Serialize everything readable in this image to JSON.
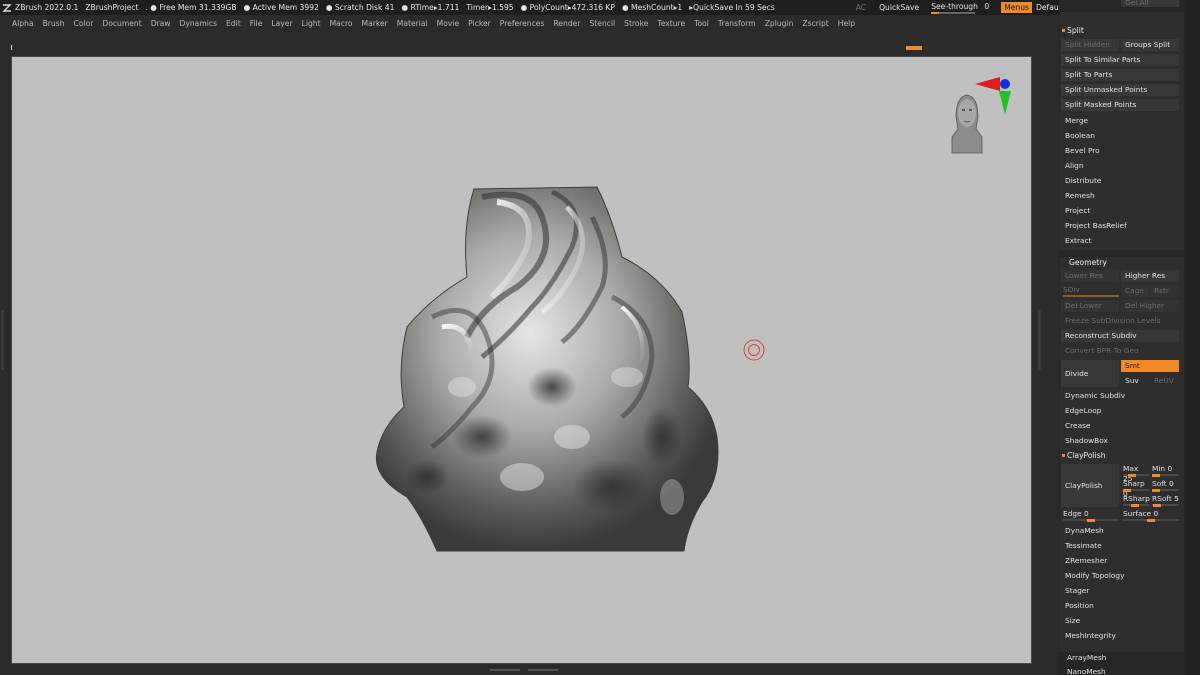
{
  "titlebar": {
    "app": "ZBrush 2022.0.1",
    "project": "ZBrushProject",
    "free_mem": ". ● Free Mem 31.339GB",
    "active_mem": "● Active Mem 3992",
    "scratch": "● Scratch Disk 41",
    "rtime": "● RTime▸1.711",
    "timer": "Timer▸1.595",
    "polycount": "● PolyCount▸472.316 KP",
    "meshcount": "● MeshCount▸1",
    "quicksave_in": "▸QuickSave In 59 Secs",
    "ac": "AC",
    "quicksave": "QuickSave",
    "see_through_label": "See-through",
    "see_through_value": "0",
    "see_through_level": 0.0,
    "menus": "Menus",
    "script": "DefaultZScript"
  },
  "menubar": [
    "Alpha",
    "Brush",
    "Color",
    "Document",
    "Draw",
    "Dynamics",
    "Edit",
    "File",
    "Layer",
    "Light",
    "Macro",
    "Marker",
    "Material",
    "Movie",
    "Picker",
    "Preferences",
    "Render",
    "Stencil",
    "Stroke",
    "Texture",
    "Tool",
    "Transform",
    "Zplugin",
    "Zscript",
    "Help"
  ],
  "split": {
    "top_cut": "Del All",
    "header": "Split",
    "split_hidden": "Split Hidden",
    "groups_split": "Groups Split",
    "items": [
      "Split To Similar Parts",
      "Split To Parts",
      "Split Unmasked Points",
      "Split Masked Points"
    ]
  },
  "subtool_actions": [
    "Merge",
    "Boolean",
    "Bevel Pro",
    "Align",
    "Distribute",
    "Remesh",
    "Project",
    "Project BasRelief",
    "Extract"
  ],
  "geometry": {
    "header": "Geometry",
    "lower_res": "Lower Res",
    "higher_res": "Higher Res",
    "sdiv": "SDiv",
    "cage": "Cage",
    "rstr": "Rstr",
    "del_lower": "Del Lower",
    "del_higher": "Del Higher",
    "freeze": "Freeze SubDivision Levels",
    "reconstruct": "Reconstruct Subdiv",
    "convert_bpr": "Convert BPR To Geo",
    "divide": "Divide",
    "smt": "Smt",
    "suv": "Suv",
    "reuv": "ReUV",
    "items": [
      "Dynamic Subdiv",
      "EdgeLoop",
      "Crease",
      "ShadowBox"
    ]
  },
  "claypolish": {
    "header": "ClayPolish",
    "button": "ClayPolish",
    "max_label": "Max",
    "max_value": "25",
    "max_level": 0.25,
    "min_label": "Min",
    "min_value": "0",
    "min_level": 0.0,
    "sharp_label": "Sharp",
    "sharp_value": "0",
    "sharp_level": 0.0,
    "soft_label": "Soft",
    "soft_value": "0",
    "soft_level": 0.0,
    "rsharp_label": "RSharp",
    "rsoft_label": "RSoft",
    "rsoft_value": "5",
    "rsoft_level": 0.05,
    "edge_label": "Edge",
    "edge_value": "0",
    "edge_level": 0.0,
    "surface_label": "Surface",
    "surface_value": "0",
    "surface_level": 0.0
  },
  "geometry_more": [
    "DynaMesh",
    "Tessimate",
    "ZRemesher",
    "Modify Topology",
    "Stager",
    "Position",
    "Size",
    "MeshIntegrity"
  ],
  "subpalettes": [
    "ArrayMesh",
    "NanoMesh"
  ],
  "colors": {
    "accent": "#f08a24",
    "canvas": "#c0c0c0",
    "ui_bg": "#2b2b2b"
  },
  "icons": [
    "zbrush-logo-icon",
    "gizmo-axis-icon",
    "head-orientation-icon",
    "brush-cursor-icon"
  ]
}
